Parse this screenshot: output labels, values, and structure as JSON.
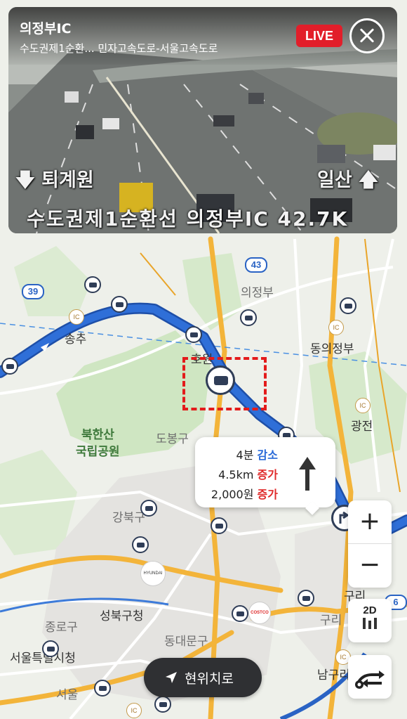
{
  "cctv": {
    "title": "의정부IC",
    "subtitle": "수도권제1순환...   민자고속도로-서울고속도로",
    "live_label": "LIVE",
    "direction_left": "🡇 퇴계원",
    "direction_right": "일산 🡅",
    "caption": "수도권제1순환선 의정부IC  42.7K"
  },
  "map": {
    "labels": {
      "uijeongbu": "의정부",
      "songchu": "송추",
      "hoewon": "호원",
      "dongeuijeongbu": "동의정부",
      "gwangjeon": "광전",
      "bukhansan": "북한산",
      "national_park": "국립공원",
      "dobong": "도봉구",
      "gangbuk": "강북구",
      "seongbuk": "성북구청",
      "jongno": "종로구",
      "dongdaemun": "동대문구",
      "seoul_cityhall": "서울특별시청",
      "seoul": "서울",
      "guri": "구리",
      "namguri": "남구리",
      "hyundai": "HYUNDAI",
      "costco": "COSTCO"
    },
    "shields": {
      "r43": "43",
      "r39": "39",
      "r6": "6"
    },
    "ic_text": "IC"
  },
  "route_info": {
    "time_change": "4분",
    "time_dir": "감소",
    "distance_change": "4.5km",
    "distance_dir": "증가",
    "toll_change": "2,000원",
    "toll_dir": "증가"
  },
  "controls": {
    "zoom_in": "+",
    "zoom_out": "−",
    "mode": "2D",
    "locate_label": "현위치로"
  },
  "colors": {
    "route": "#2f6fd8",
    "highway": "#f3b43a",
    "park": "#cfe6c2",
    "live": "#e21e2a",
    "highlight": "#e31b1b"
  }
}
